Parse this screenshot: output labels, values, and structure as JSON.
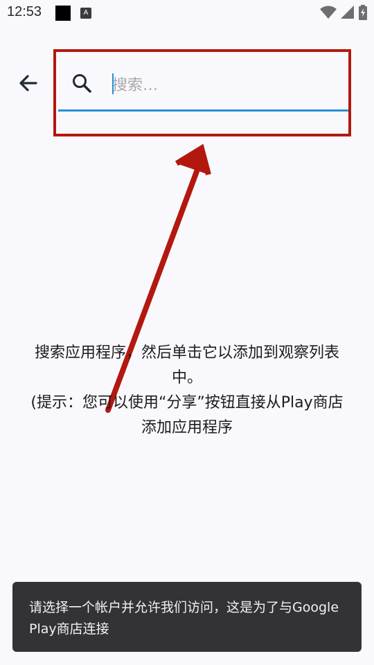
{
  "status_bar": {
    "time": "12:53",
    "notification_icon_letter": "A",
    "icons": [
      "black-square-icon",
      "a-notification-icon",
      "wifi-icon",
      "signal-icon",
      "battery-icon"
    ]
  },
  "search": {
    "placeholder": "搜索…",
    "value": ""
  },
  "hint": {
    "line1": "搜索应用程序，然后单击它以添加到观察列表中。",
    "line2": "(提示：您可以使用“分享”按钮直接从Play商店添加应用程序"
  },
  "toast": {
    "message": "请选择一个帐户并允许我们访问，这是为了与Google Play商店连接"
  },
  "colors": {
    "background": "#f8f8fd",
    "accent": "#2a8fd8",
    "annotation_red": "#b3180f",
    "toast_bg": "#333236"
  }
}
